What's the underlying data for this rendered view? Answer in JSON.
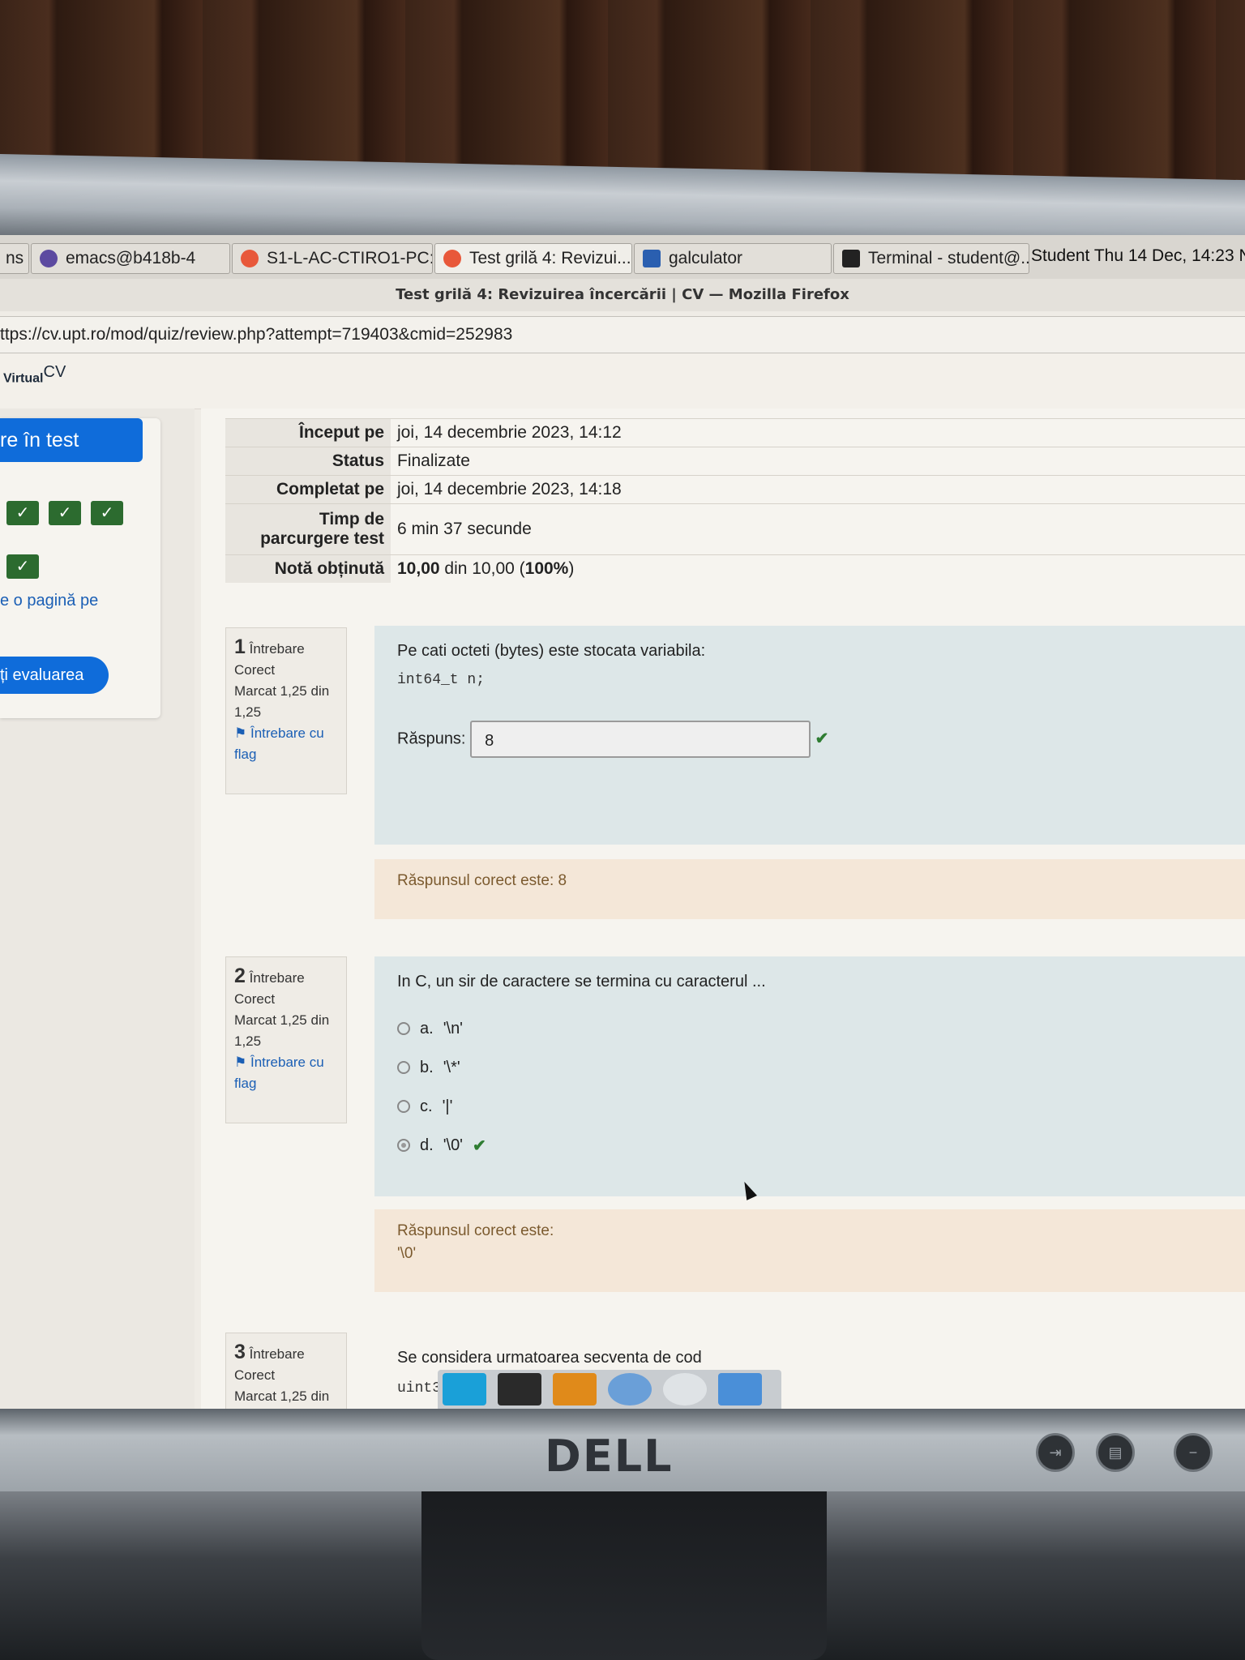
{
  "taskbar": {
    "items": [
      {
        "label": "ns ≡",
        "icon": "menu-icon"
      },
      {
        "label": "emacs@b418b-4",
        "icon": "emacs-icon"
      },
      {
        "label": "S1-L-AC-CTIRO1-PC:...",
        "icon": "firefox-icon"
      },
      {
        "label": "Test grilă 4: Revizui...",
        "icon": "firefox-icon"
      },
      {
        "label": "galculator",
        "icon": "calculator-icon"
      },
      {
        "label": "Terminal - student@...",
        "icon": "terminal-icon"
      }
    ],
    "clock": "Student Thu 14 Dec, 14:23 N"
  },
  "window": {
    "title": "Test grilă 4: Revizuirea încercării | CV — Mozilla Firefox",
    "url": "ttps://cv.upt.ro/mod/quiz/review.php?attempt=719403&cmid=252983"
  },
  "site": {
    "brand": "Virtual",
    "brand_sup": "CV"
  },
  "nav": {
    "header": "re în test",
    "page_link": "e o pagină pe",
    "finish_button": "ți evaluarea"
  },
  "summary": [
    {
      "key": "Început pe",
      "value": "joi, 14 decembrie 2023, 14:12"
    },
    {
      "key": "Status",
      "value": "Finalizate"
    },
    {
      "key": "Completat pe",
      "value": "joi, 14 decembrie 2023, 14:18"
    },
    {
      "key": "Timp de parcurgere test",
      "value": "6 min 37 secunde"
    },
    {
      "key": "Notă obținută",
      "value_bold": "10,00",
      "value_rest": " din 10,00 (",
      "value_pct": "100%",
      "value_end": ")"
    }
  ],
  "questions": {
    "q1": {
      "number": "1",
      "label": "Întrebare",
      "state": "Corect",
      "marks": "Marcat 1,25 din 1,25",
      "flag": "Întrebare cu flag",
      "text": "Pe cati octeti (bytes) este stocata variabila:",
      "code": "int64_t n;",
      "answer_label": "Răspuns:",
      "answer_value": "8",
      "feedback": "Răspunsul corect este: 8"
    },
    "q2": {
      "number": "2",
      "label": "Întrebare",
      "state": "Corect",
      "marks": "Marcat 1,25 din 1,25",
      "flag": "Întrebare cu flag",
      "text": "In C, un sir de caractere se termina cu caracterul ...",
      "options": [
        {
          "letter": "a.",
          "text": "'\\n'"
        },
        {
          "letter": "b.",
          "text": "'\\*'"
        },
        {
          "letter": "c.",
          "text": "'|'"
        },
        {
          "letter": "d.",
          "text": "'\\0'"
        }
      ],
      "selected": "d",
      "feedback_title": "Răspunsul corect este:",
      "feedback_value": "'\\0'"
    },
    "q3": {
      "number": "3",
      "label": "Întrebare",
      "state": "Corect",
      "marks": "Marcat 1,25 din",
      "text": "Se considera urmatoarea secventa de cod",
      "code": "uint3"
    }
  },
  "colors": {
    "accent": "#0f6cda",
    "correct": "#2e7d32",
    "question_bg": "#dde7e8",
    "feedback_bg": "#f4e7d8"
  }
}
